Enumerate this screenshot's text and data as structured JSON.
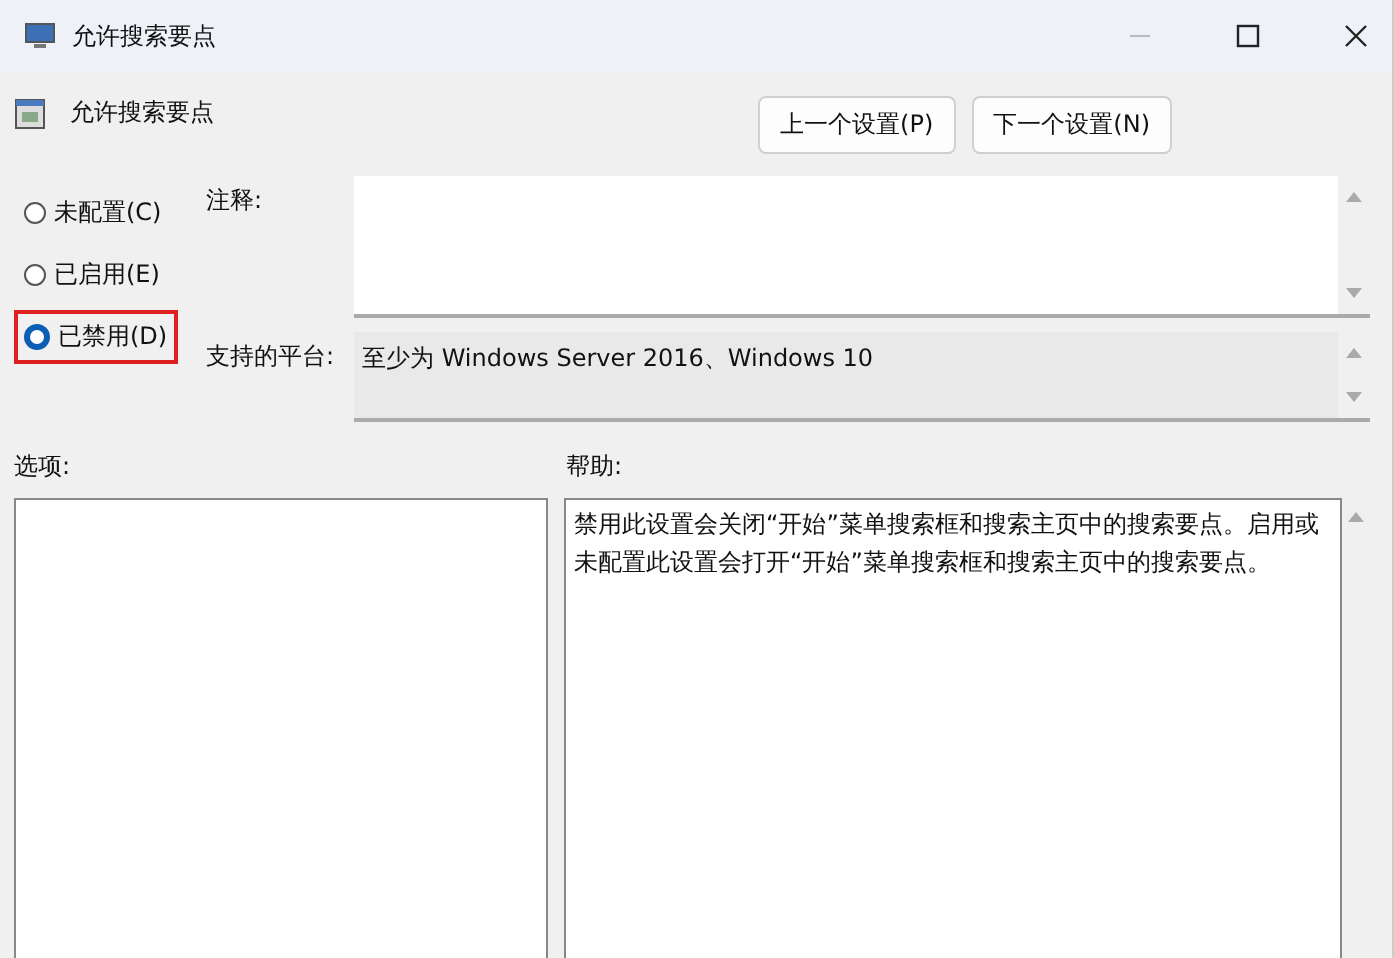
{
  "window": {
    "title": "允许搜索要点"
  },
  "heading": "允许搜索要点",
  "nav_buttons": [
    "上一个设置(P)",
    "下一个设置(N)"
  ],
  "states": [
    {
      "label": "未配置(C)",
      "selected": false,
      "highlighted": false
    },
    {
      "label": "已启用(E)",
      "selected": false,
      "highlighted": false
    },
    {
      "label": "已禁用(D)",
      "selected": true,
      "highlighted": true
    }
  ],
  "comment": {
    "label": "注释:"
  },
  "platform": {
    "label": "支持的平台:",
    "value": "至少为 Windows Server 2016、Windows 10"
  },
  "options": {
    "label": "选项:"
  },
  "help": {
    "label": "帮助:",
    "text": "禁用此设置会关闭“开始”菜单搜索框和搜索主页中的搜索要点。启用或未配置此设置会打开“开始”菜单搜索框和搜索主页中的搜索要点。"
  }
}
